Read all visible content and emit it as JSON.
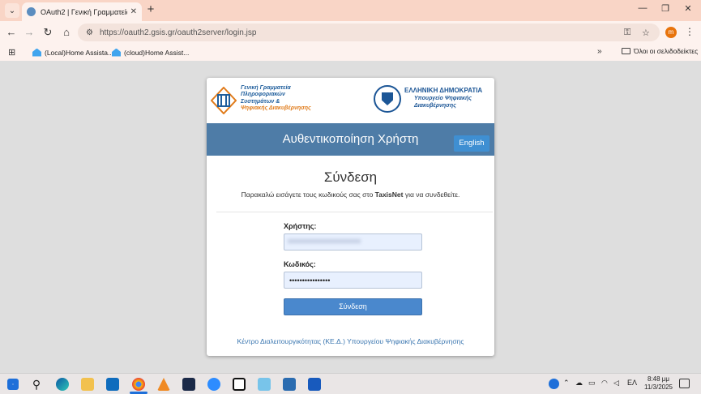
{
  "browser": {
    "tab_title": "OAuth2 | Γενική Γραμματεία Π...",
    "tab_close": "✕",
    "new_tab": "+",
    "url": "https://oauth2.gsis.gr/oauth2server/login.jsp",
    "profile_initial": "m",
    "bookmarks": [
      {
        "label": "(Local)Home Assista..."
      },
      {
        "label": "(cloud)Home Assist..."
      }
    ],
    "all_bookmarks": "Όλοι οι σελιδοδείκτες"
  },
  "logos": {
    "gsis_lines": [
      "Γενική Γραμματεία",
      "Πληροφοριακών",
      "Συστημάτων &",
      "Ψηφιακής Διακυβέρνησης"
    ],
    "gr_title": "ΕΛΛΗΝΙΚΗ ΔΗΜΟΚΡΑΤΙΑ",
    "gr_sub_1": "Υπουργείο Ψηφιακής",
    "gr_sub_2": "Διακυβέρνησης"
  },
  "header": {
    "title": "Αυθεντικοποίηση Χρήστη",
    "lang_button": "English"
  },
  "login": {
    "heading": "Σύνδεση",
    "intro_before": "Παρακαλώ εισάγετε τους κωδικούς σας στο ",
    "intro_bold": "TaxisNet",
    "intro_after": " για να συνδεθείτε.",
    "user_label": "Χρήστης:",
    "user_value": "",
    "pass_label": "Κωδικός:",
    "pass_value": "••••••••••••••••",
    "submit_label": "Σύνδεση",
    "footer_link": "Κέντρο Διαλειτουργικότητας (ΚΕ.Δ.) Υπουργείου Ψηφιακής Διακυβέρνησης"
  },
  "taskbar": {
    "lang": "ΕΛ",
    "time": "8:48 μμ",
    "date": "11/3/2025"
  }
}
